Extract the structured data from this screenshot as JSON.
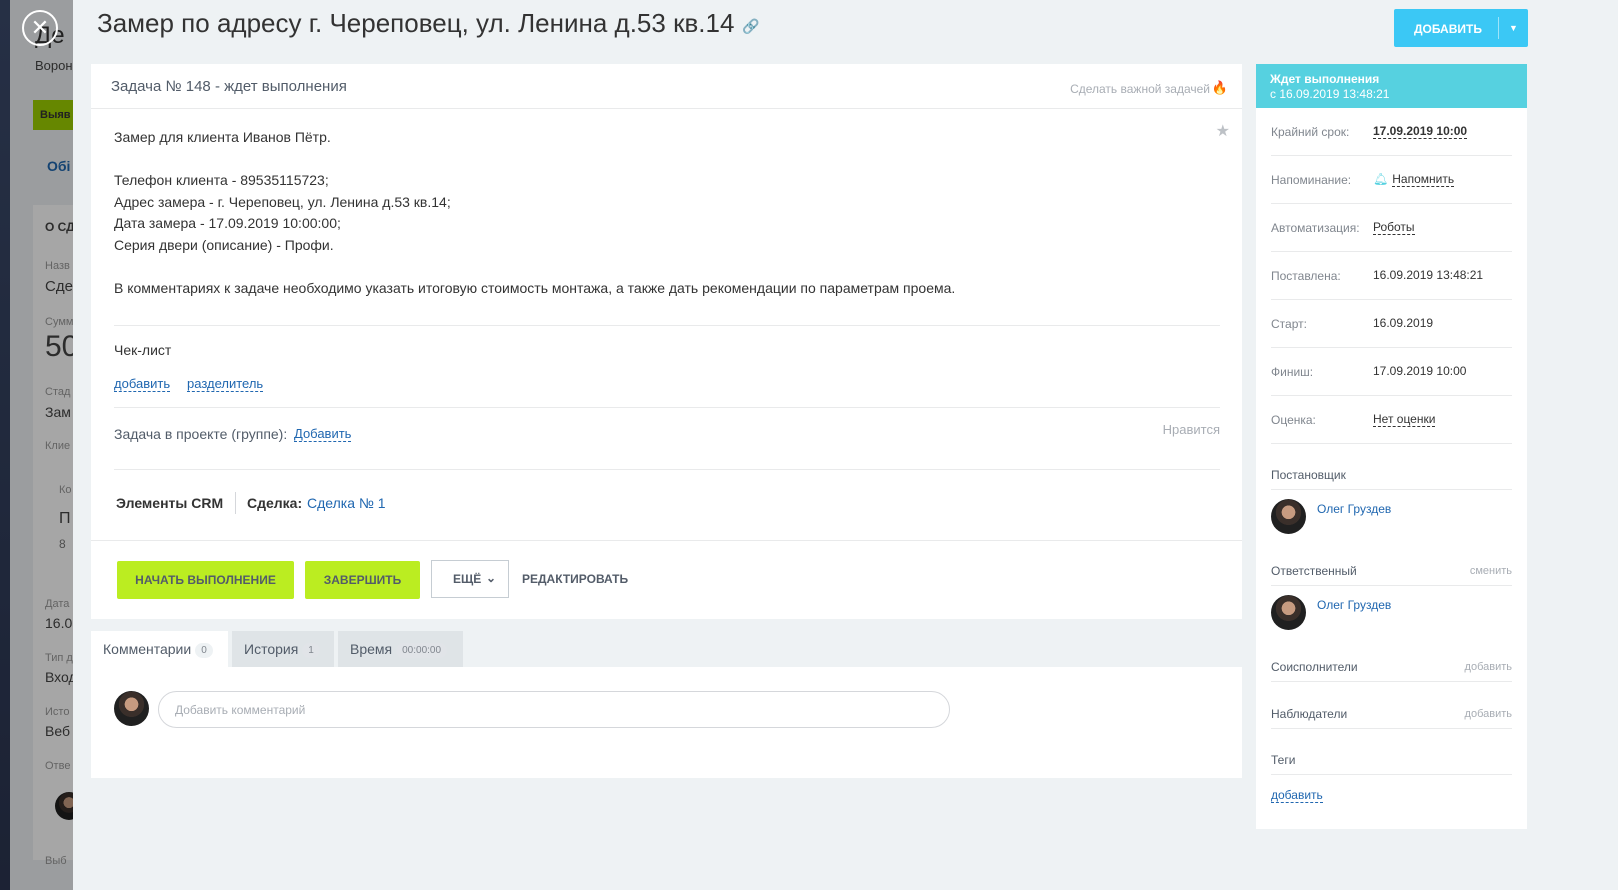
{
  "background": {
    "title_fragment": "Де",
    "subtitle_fragment": "Ворон",
    "button_fragment": "Выяв",
    "tab_fragment": "Обі",
    "section_fragment": "О СД",
    "rows": [
      "Назв",
      "Сде",
      "Сумм",
      "50",
      "Стад",
      "Зам",
      "Клие",
      "Ко",
      "П",
      "8",
      "Дата",
      "16.0",
      "Тип д",
      "Вход",
      "Исто",
      "Веб",
      "Отве",
      "Выб"
    ]
  },
  "header": {
    "title": "Замер по адресу г. Череповец, ул. Ленина д.53 кв.14",
    "add_button": "ДОБАВИТЬ"
  },
  "task": {
    "heading": "Задача № 148 - ждет выполнения",
    "make_important": "Сделать важной задачей",
    "description": [
      "Замер для клиента Иванов Пётр.",
      "",
      "Телефон клиента - 89535115723;",
      "Адрес замера - г. Череповец, ул. Ленина д.53 кв.14;",
      "Дата замера - 17.09.2019 10:00:00;",
      "Серия двери (описание) - Профи.",
      "",
      "В комментариях к задаче необходимо указать итоговую стоимость монтажа, а также дать рекомендации по параметрам проема."
    ],
    "checklist_title": "Чек-лист",
    "checklist_add": "добавить",
    "checklist_separator": "разделитель",
    "project_label": "Задача в проекте (группе):",
    "project_add": "Добавить",
    "likes": "Нравится",
    "crm_label": "Элементы CRM",
    "deal_label": "Сделка:",
    "deal_link": "Сделка № 1",
    "buttons": {
      "start": "НАЧАТЬ ВЫПОЛНЕНИЕ",
      "finish": "ЗАВЕРШИТЬ",
      "more": "ЕЩЁ",
      "edit": "РЕДАКТИРОВАТЬ"
    }
  },
  "tabs": [
    {
      "label": "Комментарии",
      "count": "0"
    },
    {
      "label": "История",
      "count": "1"
    },
    {
      "label": "Время",
      "count": "00:00:00"
    }
  ],
  "comments": {
    "placeholder": "Добавить комментарий"
  },
  "sidebar": {
    "status_title": "Ждет выполнения",
    "status_since": "с 16.09.2019 13:48:21",
    "rows": [
      {
        "key": "Крайний срок:",
        "value": "17.09.2019 10:00"
      },
      {
        "key": "Напоминание:",
        "value": "Напомнить"
      },
      {
        "key": "Автоматизация:",
        "value": "Роботы"
      },
      {
        "key": "Поставлена:",
        "value": "16.09.2019 13:48:21"
      },
      {
        "key": "Старт:",
        "value": "16.09.2019"
      },
      {
        "key": "Финиш:",
        "value": "17.09.2019 10:00"
      },
      {
        "key": "Оценка:",
        "value": "Нет оценки"
      }
    ],
    "creator_title": "Постановщик",
    "creator_name": "Олег Груздев",
    "responsible_title": "Ответственный",
    "responsible_change": "сменить",
    "responsible_name": "Олег Груздев",
    "coexecutors_title": "Соисполнители",
    "coexecutors_add": "добавить",
    "observers_title": "Наблюдатели",
    "observers_add": "добавить",
    "tags_title": "Теги",
    "tags_add": "добавить"
  },
  "colors": {
    "accent_blue": "#3bc8f5",
    "status_cyan": "#56d1e0",
    "action_green": "#bbed21",
    "link_blue": "#2067b0"
  },
  "icons": [
    "close-icon",
    "link-icon",
    "fire-icon",
    "star-icon",
    "bell-icon",
    "chevron-down-icon"
  ]
}
